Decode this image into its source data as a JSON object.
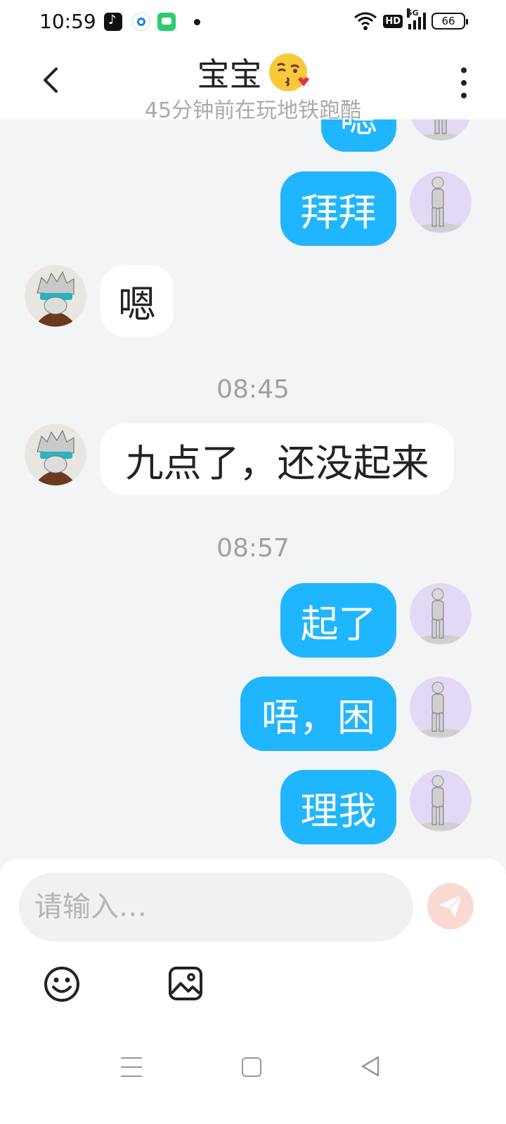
{
  "status_bar": {
    "time": "10:59",
    "hd": "HD",
    "network": "5G",
    "battery": "66"
  },
  "header": {
    "title": "宝宝",
    "title_emoji": "face-blowing-kiss",
    "subtitle": "45分钟前在玩地铁跑酷"
  },
  "messages": [
    {
      "side": "out",
      "text": "嗯",
      "partial": true
    },
    {
      "side": "out",
      "text": "拜拜"
    },
    {
      "side": "in",
      "text": "嗯"
    },
    {
      "type": "timestamp",
      "text": "08:45"
    },
    {
      "side": "in",
      "text": "九点了，还没起来"
    },
    {
      "type": "timestamp",
      "text": "08:57"
    },
    {
      "side": "out",
      "text": "起了"
    },
    {
      "side": "out",
      "text": "唔，困"
    },
    {
      "side": "out",
      "text": "理我"
    }
  ],
  "input": {
    "placeholder": "请输入…"
  },
  "icons": {
    "back": "chevron-left-icon",
    "more": "more-vertical-icon",
    "send": "send-icon",
    "emoji": "smiley-icon",
    "image": "image-icon"
  },
  "colors": {
    "outgoing_bubble": "#20b5ff",
    "incoming_bubble": "#ffffff",
    "background": "#f3f4f6",
    "send_button": "#fbd9d3"
  }
}
